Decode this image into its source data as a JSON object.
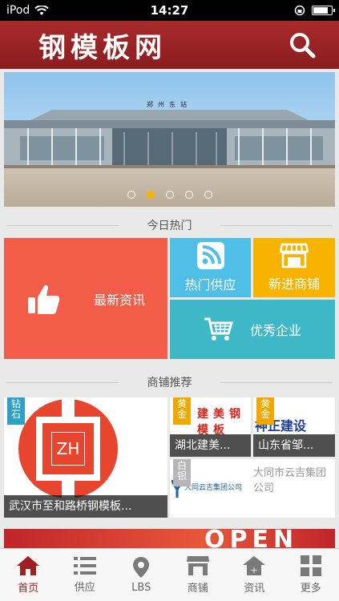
{
  "status": {
    "carrier": "iPod",
    "time": "14:27",
    "battery_level": 0.85
  },
  "header": {
    "title": "钢模板网"
  },
  "banner": {
    "station_sign": "郑州东站",
    "slide_count": 5,
    "active_slide": 2
  },
  "sections": {
    "hot_today": "今日热门",
    "shop_recommend": "商铺推荐"
  },
  "tiles": {
    "news": "最新资讯",
    "supply": "热门供应",
    "new_shops": "新进商铺",
    "top_companies": "优秀企业"
  },
  "shops": [
    {
      "badge": "钻石",
      "name": "武汉市至和路桥钢模板...",
      "logo_text": "ZH"
    },
    {
      "badge": "黄金",
      "name": "湖北建美...",
      "logo_text": "建美钢模板"
    },
    {
      "badge": "黄金",
      "name": "山东省邹...",
      "logo_text": "神正建设"
    },
    {
      "badge": "白银",
      "name": "大同市云吉集团公司",
      "logo_text": "大同云吉集团公司"
    }
  ],
  "promo": {
    "text": "OPEN"
  },
  "colors": {
    "brand": "#9b2224",
    "news_tile": "#f35c49",
    "supply_tile": "#4fbfe8",
    "shop_tile": "#f7b300",
    "biz_tile": "#3eb8c6"
  },
  "tabs": [
    {
      "label": "首页",
      "icon": "home-icon",
      "active": true
    },
    {
      "label": "供应",
      "icon": "list-icon"
    },
    {
      "label": "LBS",
      "icon": "location-pin-icon"
    },
    {
      "label": "商铺",
      "icon": "store-icon"
    },
    {
      "label": "资讯",
      "icon": "news-icon"
    },
    {
      "label": "更多",
      "icon": "grid-icon"
    }
  ]
}
